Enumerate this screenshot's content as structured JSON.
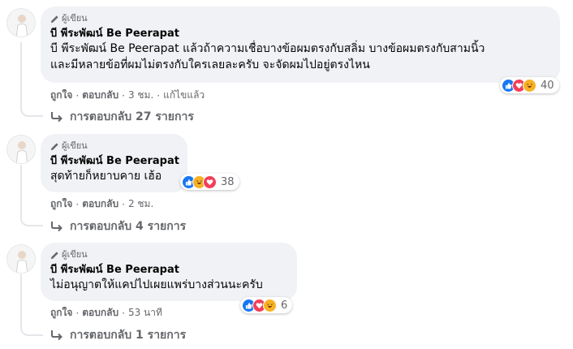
{
  "comments": [
    {
      "badge": "ผู้เขียน",
      "author": "บี พีระพัฒน์ Be Peerapat",
      "lines": [
        "บี พีระพัฒน์ Be Peerapat แล้วถ้าความเชื่อบางข้อผมตรงกับสลิ่ม บางข้อผมตรงกับสามนิ้ว",
        "และมีหลายข้อที่ผมไม่ตรงกับใครเลยละครับ จะจัดผมไปอยู่ตรงไหน"
      ],
      "reaction_count": "40",
      "like_label": "ถูกใจ",
      "reply_label": "ตอบกลับ",
      "time": "3 ชม.",
      "edited": "แก้ไขแล้ว",
      "replies_label": "การตอบกลับ 27 รายการ"
    },
    {
      "badge": "ผู้เขียน",
      "author": "บี พีระพัฒน์ Be Peerapat",
      "lines": [
        "สุดท้ายก็หยาบคาย เฮ้อ"
      ],
      "reaction_count": "38",
      "like_label": "ถูกใจ",
      "reply_label": "ตอบกลับ",
      "time": "2 ชม.",
      "replies_label": "การตอบกลับ 4 รายการ"
    },
    {
      "badge": "ผู้เขียน",
      "author": "บี พีระพัฒน์ Be Peerapat",
      "lines": [
        "ไม่อนุญาตให้แคปไปเผยแพร่บางส่วนนะครับ"
      ],
      "reaction_count": "6",
      "like_label": "ถูกใจ",
      "reply_label": "ตอบกลับ",
      "time": "53 นาที",
      "replies_label": "การตอบกลับ 1 รายการ"
    }
  ],
  "colors": {
    "like": "#1877f2",
    "love": "#f33e58",
    "haha": "#f7b125",
    "bubble": "#f0f2f5",
    "muted": "#65676b"
  },
  "icons": [
    "pencil-icon",
    "like-reaction-icon",
    "love-reaction-icon",
    "haha-reaction-icon",
    "reply-arrow-icon"
  ]
}
